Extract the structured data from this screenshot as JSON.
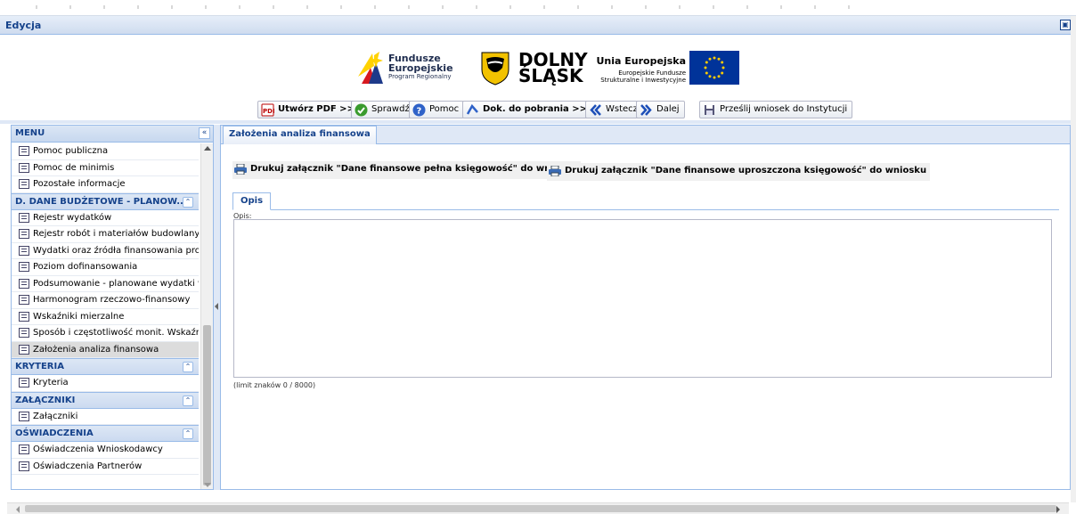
{
  "window": {
    "title": "Edycja"
  },
  "logos": {
    "fe_line1": "Fundusze",
    "fe_line2": "Europejskie",
    "fe_line3": "Program Regionalny",
    "ds_line1": "DOLNY",
    "ds_line2": "ŚLĄSK",
    "ue_line1": "Unia Europejska",
    "ue_line2": "Europejskie Fundusze",
    "ue_line3": "Strukturalne i Inwestycyjne"
  },
  "toolbar": {
    "pdf": "Utwórz PDF >>",
    "check": "Sprawdź",
    "help": "Pomoc",
    "download": "Dok. do pobrania >>",
    "back": "Wstecz",
    "next": "Dalej",
    "send": "Prześlij wniosek do Instytucji"
  },
  "sidebar": {
    "title": "MENU",
    "items_top": [
      "Pomoc publiczna",
      "Pomoc de minimis",
      "Pozostałe informacje"
    ],
    "group_d": "D. DANE BUDŻETOWE - PLANOW...",
    "items_d": [
      "Rejestr wydatków",
      "Rejestr robót i materiałów budowlanyc",
      "Wydatki oraz źródła finansowania proj",
      "Poziom dofinansowania",
      "Podsumowanie - planowane wydatki w",
      "Harmonogram rzeczowo-finansowy",
      "Wskaźniki mierzalne",
      "Sposób i częstotliwość monit. Wskaźni",
      "Założenia analiza finansowa"
    ],
    "group_k": "KRYTERIA",
    "items_k": [
      "Kryteria"
    ],
    "group_z": "ZAŁĄCZNIKI",
    "items_z": [
      "Załączniki"
    ],
    "group_o": "OŚWIADCZENIA",
    "items_o": [
      "Oświadczenia Wnioskodawcy",
      "Oświadczenia Partnerów"
    ]
  },
  "main": {
    "tab": "Założenia analiza finansowa",
    "print_full": "Drukuj załącznik \"Dane finansowe pełna księgowość\" do wniosku",
    "print_simple": "Drukuj załącznik \"Dane finansowe uproszczona księgowość\" do wniosku",
    "subtab": "Opis",
    "field_label": "Opis:",
    "field_value": "",
    "limit": "(limit znaków 0 / 8000)"
  }
}
